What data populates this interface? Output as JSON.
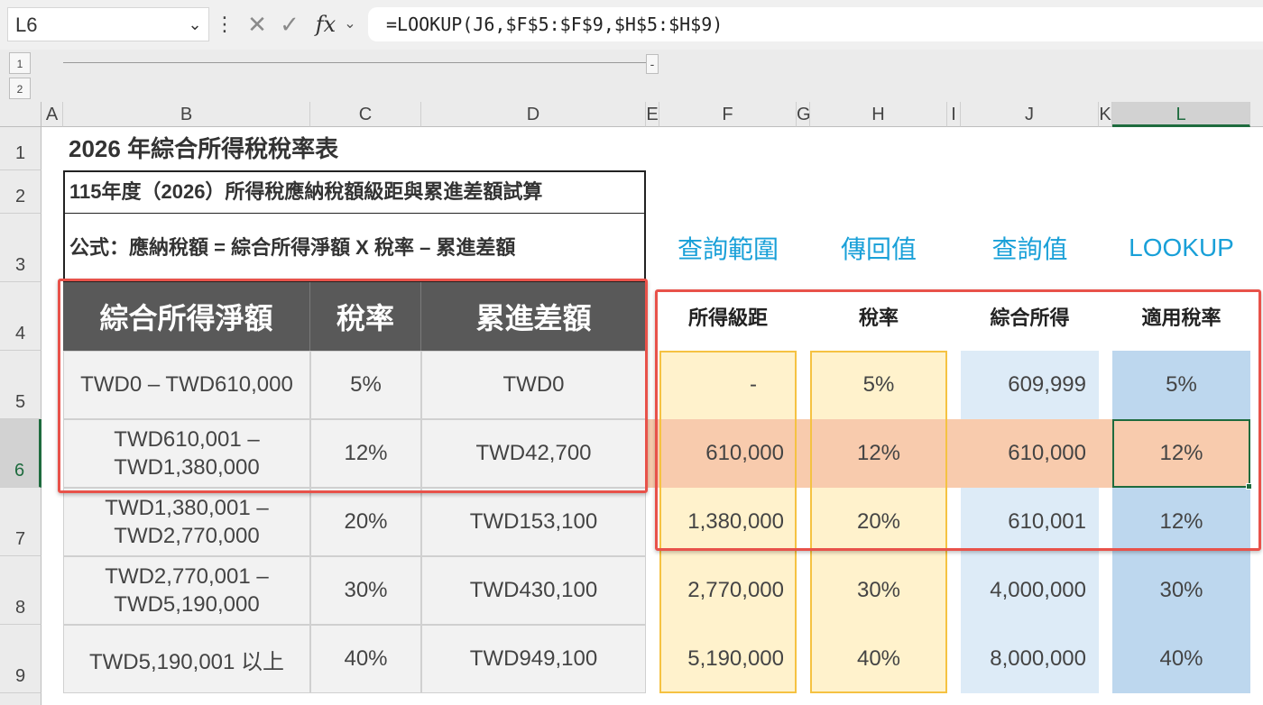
{
  "formula_bar": {
    "name_box": "L6",
    "cancel_icon": "✕",
    "enter_icon": "✓",
    "fx_label": "fx",
    "formula": "=LOOKUP(J6,$F$5:$F$9,$H$5:$H$9)"
  },
  "outline": {
    "levels": [
      "1",
      "2"
    ],
    "collapse_label": "-"
  },
  "columns": [
    "A",
    "B",
    "C",
    "D",
    "E",
    "F",
    "G",
    "H",
    "I",
    "J",
    "K",
    "L"
  ],
  "selected_column": "L",
  "rows": [
    "1",
    "2",
    "3",
    "4",
    "5",
    "6",
    "7",
    "8",
    "9"
  ],
  "selected_row": "6",
  "sheet": {
    "title": "2026 年綜合所得稅稅率表",
    "subtitle": "115年度（2026）所得稅應納稅額級距與累進差額試算",
    "formula_note": "公式：應納稅額 = 綜合所得淨額 X 稅率 – 累進差額",
    "left_table": {
      "headers": [
        "綜合所得淨額",
        "稅率",
        "累進差額"
      ],
      "rows": [
        [
          "TWD0 – TWD610,000",
          "5%",
          "TWD0"
        ],
        [
          "TWD610,001 –\nTWD1,380,000",
          "12%",
          "TWD42,700"
        ],
        [
          "TWD1,380,001 –\nTWD2,770,000",
          "20%",
          "TWD153,100"
        ],
        [
          "TWD2,770,001 –\nTWD5,190,000",
          "30%",
          "TWD430,100"
        ],
        [
          "TWD5,190,001 以上",
          "40%",
          "TWD949,100"
        ]
      ]
    },
    "labels": {
      "F": "查詢範圍",
      "H": "傳回值",
      "J": "查詢值",
      "L": "LOOKUP"
    },
    "right_headers": {
      "F": "所得級距",
      "H": "稅率",
      "J": "綜合所得",
      "L": "適用稅率"
    },
    "right_table": [
      {
        "F": "-",
        "H": "5%",
        "J": "609,999",
        "L": "5%"
      },
      {
        "F": "610,000",
        "H": "12%",
        "J": "610,000",
        "L": "12%"
      },
      {
        "F": "1,380,000",
        "H": "20%",
        "J": "610,001",
        "L": "12%"
      },
      {
        "F": "2,770,000",
        "H": "30%",
        "J": "4,000,000",
        "L": "30%"
      },
      {
        "F": "5,190,000",
        "H": "40%",
        "J": "8,000,000",
        "L": "40%"
      }
    ]
  },
  "colors": {
    "highlight_box": "#e8524a",
    "yellow_border": "#f5c242",
    "selection_green": "#1e6b3e",
    "label_blue": "#19a0d8"
  }
}
